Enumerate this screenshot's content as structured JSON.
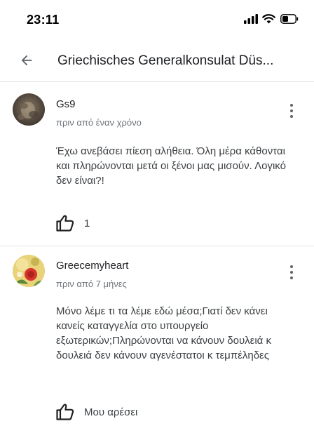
{
  "status_bar": {
    "time": "23:11",
    "icons": [
      "cellular-signal-icon",
      "wifi-icon",
      "battery-icon"
    ]
  },
  "app_bar": {
    "back_icon": "arrow-back-icon",
    "title": "Griechisches Generalkonsulat Düs..."
  },
  "reviews": [
    {
      "author": "Gs9",
      "time": "πριν από έναν χρόνο",
      "text": "Έχω ανεβάσει πίεση αλήθεια. Όλη μέρα κάθονται και πληρώνονται μετά οι ξένοι μας μισούν. Λογικό δεν είναι?!",
      "like_label": "1",
      "more_icon": "more-vert-icon",
      "like_icon": "thumbs-up-icon"
    },
    {
      "author": "Greecemyheart",
      "time": "πριν από 7 μήνες",
      "text": "Μόνο λέμε τι τα λέμε εδώ μέσα;Γιατί δεν κάνει κανείς καταγγελία στο υπουργείο εξωτερικών;Πληρώνονται να κάνουν δουλειά κ δουλειά δεν κάνουν αγενέστατοι κ τεμπέληδες",
      "like_label": "Μου αρέσει",
      "more_icon": "more-vert-icon",
      "like_icon": "thumbs-up-icon"
    }
  ],
  "colors": {
    "text_primary": "#202124",
    "text_secondary": "#70757a",
    "divider": "#e3e3e3"
  }
}
